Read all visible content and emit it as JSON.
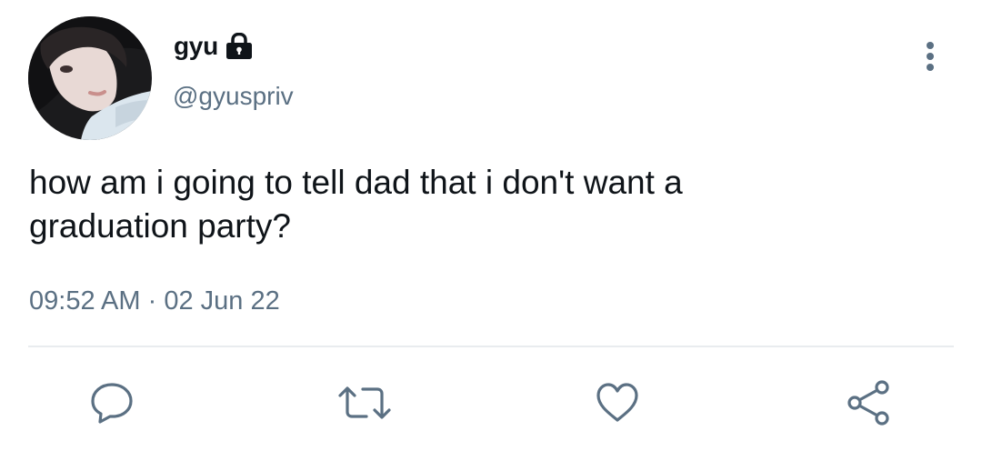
{
  "tweet": {
    "display_name": "gyu",
    "handle": "@gyuspriv",
    "text": "how am i going to tell dad that i don't want a\ngraduation party?",
    "timestamp": "09:52 AM",
    "separator": " · ",
    "date": "02 Jun 22",
    "locked": true
  },
  "actions": [
    {
      "name": "reply",
      "icon": "comment-bubble-icon"
    },
    {
      "name": "retweet",
      "icon": "retweet-arrows-icon"
    },
    {
      "name": "like",
      "icon": "heart-icon"
    },
    {
      "name": "share",
      "icon": "share-icon"
    }
  ],
  "colors": {
    "text": "#0f1419",
    "secondary": "#5b7083",
    "divider": "#e9ecef",
    "background": "#ffffff"
  }
}
